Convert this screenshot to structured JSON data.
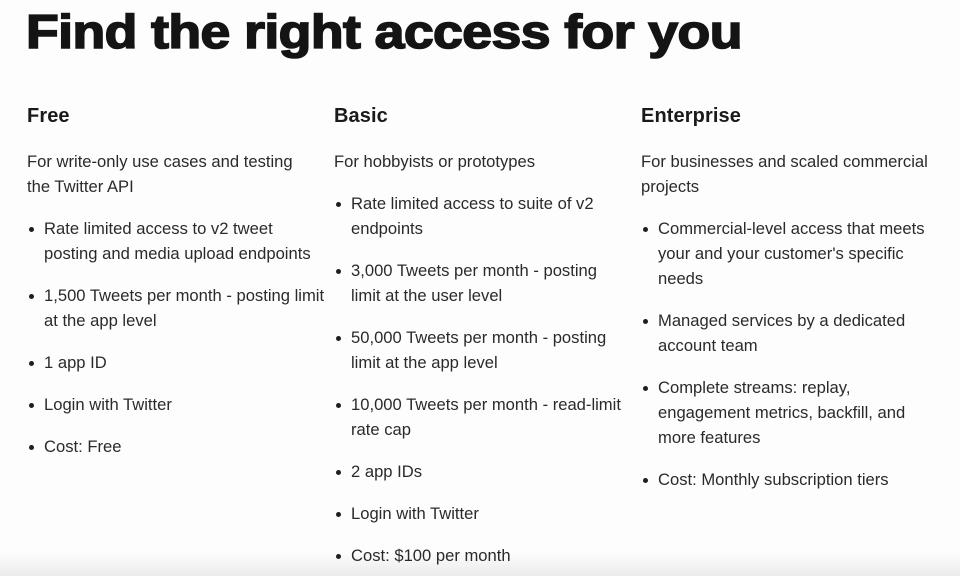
{
  "page": {
    "title": "Find the right access for you"
  },
  "tiers": [
    {
      "name": "Free",
      "description": "For write-only use cases and testing the Twitter API",
      "features": [
        "Rate limited access to v2 tweet posting and media upload endpoints",
        "1,500 Tweets per month - posting limit at the app level",
        "1 app ID",
        "Login with Twitter",
        "Cost: Free"
      ]
    },
    {
      "name": "Basic",
      "description": "For hobbyists or prototypes",
      "features": [
        "Rate limited access to suite of v2 endpoints",
        "3,000 Tweets per month - posting limit at the user level",
        "50,000 Tweets per month - posting limit at the app level",
        "10,000 Tweets per month - read-limit rate cap",
        "2 app IDs",
        "Login with Twitter",
        "Cost: $100 per month"
      ]
    },
    {
      "name": "Enterprise",
      "description": "For businesses and scaled commercial projects",
      "features": [
        "Commercial-level access that meets your and your customer's specific needs",
        "Managed services by a dedicated account team",
        "Complete streams: replay, engagement metrics, backfill, and more features",
        "Cost: Monthly subscription tiers"
      ]
    }
  ]
}
